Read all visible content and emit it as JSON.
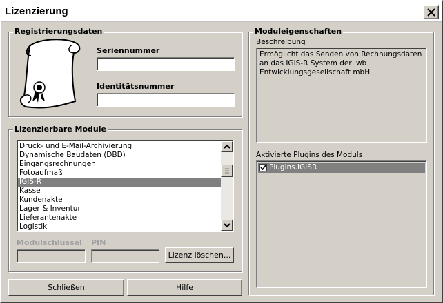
{
  "window": {
    "title": "Lizenzierung"
  },
  "registration": {
    "group_label": "Registrierungsdaten",
    "serial_label_accel": "S",
    "serial_label_rest": "eriennummer",
    "serial_value": "",
    "identity_label_accel": "I",
    "identity_label_rest": "dentitätsnummer",
    "identity_value": ""
  },
  "modules": {
    "group_label": "Lizenzierbare Module",
    "items": [
      "Druck- und E-Mail-Archivierung",
      "Dynamische Baudaten (DBD)",
      "Eingangsrechnungen",
      "Fotoaufmaß",
      "IGIS-R",
      "Kasse",
      "Kundenakte",
      "Lager & Inventur",
      "Lieferantenakte",
      "Logistik"
    ],
    "selected_item": "IGIS-R",
    "module_key_label": "Modulschlüssel",
    "pin_label": "PIN",
    "module_key_value": "",
    "pin_value": "",
    "delete_license_label": "Lizenz löschen..."
  },
  "properties": {
    "group_label": "Moduleigenschaften",
    "description_label": "Beschreibung",
    "description_text": "Ermöglicht das Senden von Rechnungsdaten an das IGIS-R System der iwb Entwicklungsgesellschaft mbH.",
    "plugins_label": "Aktivierte Plugins des Moduls",
    "plugins": [
      {
        "name": "Plugins.IGISR",
        "checked": true
      }
    ]
  },
  "footer": {
    "close_label": "Schließen",
    "help_label": "Hilfe"
  },
  "icons": {
    "title_close": "close-icon",
    "certificate": "certificate-scroll-icon",
    "scroll_up": "arrow-up-icon",
    "scroll_down": "arrow-down-icon",
    "checkmark": "checkmark-icon"
  },
  "colors": {
    "dialog_bg": "#d4d0c8",
    "selection_bg": "#808080",
    "field_bg": "#ffffff"
  }
}
